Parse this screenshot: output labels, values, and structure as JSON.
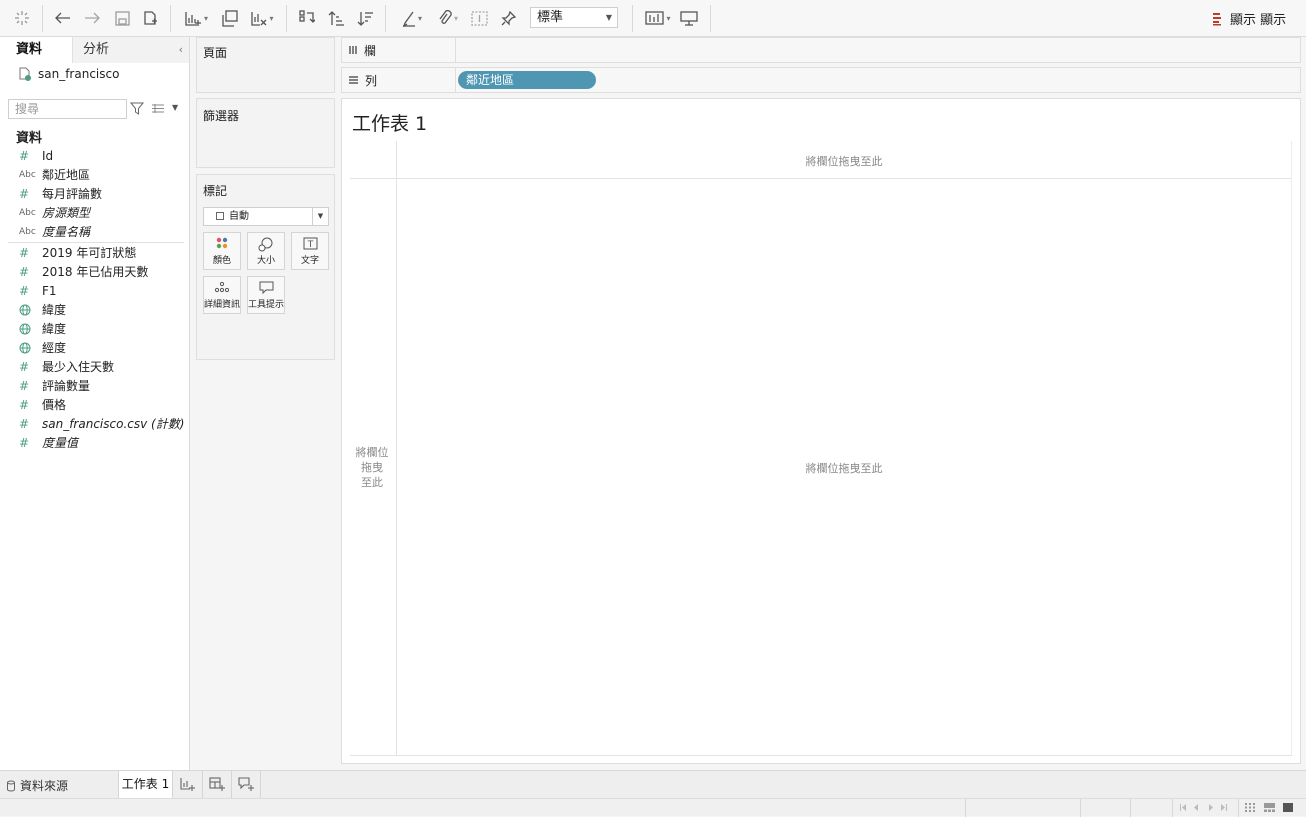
{
  "toolbar": {
    "mark_type_select": "標準",
    "show_me": "顯示 顯示",
    "icons": [
      "tableau-logo-icon",
      "undo-icon",
      "redo-icon",
      "save-icon",
      "new-datasource-icon",
      "new-worksheet-icon",
      "duplicate-sheet-icon",
      "clear-sheet-icon",
      "swap-icon",
      "sort-ascending-icon",
      "sort-descending-icon",
      "highlight-icon",
      "group-icon",
      "labels-icon",
      "pin-icon",
      "fit-icon",
      "presentation-icon",
      "show-me-icon"
    ]
  },
  "left_pane": {
    "tabs": {
      "data": "資料",
      "analysis": "分析"
    },
    "datasource_name": "san_francisco",
    "search_placeholder": "搜尋",
    "data_header": "資料",
    "dimensions": [
      {
        "type": "#",
        "name": "Id"
      },
      {
        "type": "Abc",
        "name": "鄰近地區"
      },
      {
        "type": "#",
        "name": "每月評論數"
      },
      {
        "type": "Abc",
        "name": "房源類型"
      },
      {
        "type": "Abc",
        "name": "度量名稱"
      }
    ],
    "measures": [
      {
        "type": "#",
        "name": "2019 年可訂狀態"
      },
      {
        "type": "#",
        "name": "2018 年已佔用天數"
      },
      {
        "type": "#",
        "name": "F1"
      },
      {
        "type": "globe",
        "name": "緯度"
      },
      {
        "type": "globe",
        "name": "緯度"
      },
      {
        "type": "globe",
        "name": "經度"
      },
      {
        "type": "#",
        "name": "最少入住天數"
      },
      {
        "type": "#",
        "name": "評論數量"
      },
      {
        "type": "#",
        "name": "價格"
      },
      {
        "type": "#",
        "name": "san_francisco.csv (計數)"
      },
      {
        "type": "#",
        "name": "度量值"
      }
    ]
  },
  "cards": {
    "pages": "頁面",
    "filters": "篩選器",
    "marks": {
      "title": "標記",
      "type": "自動",
      "buttons": {
        "color": "顏色",
        "size": "大小",
        "text": "文字",
        "detail": "詳細資訊",
        "tooltip": "工具提示"
      }
    }
  },
  "shelves": {
    "columns_label": "欄",
    "rows_label": "列",
    "rows_pill": "鄰近地區"
  },
  "view": {
    "sheet_title": "工作表 1",
    "drop_top": "將欄位拖曳至此",
    "drop_left": "將欄位拖曳至此",
    "drop_center": "將欄位拖曳至此"
  },
  "bottom_tabs": {
    "datasource": "資料來源",
    "sheet": "工作表 1"
  }
}
